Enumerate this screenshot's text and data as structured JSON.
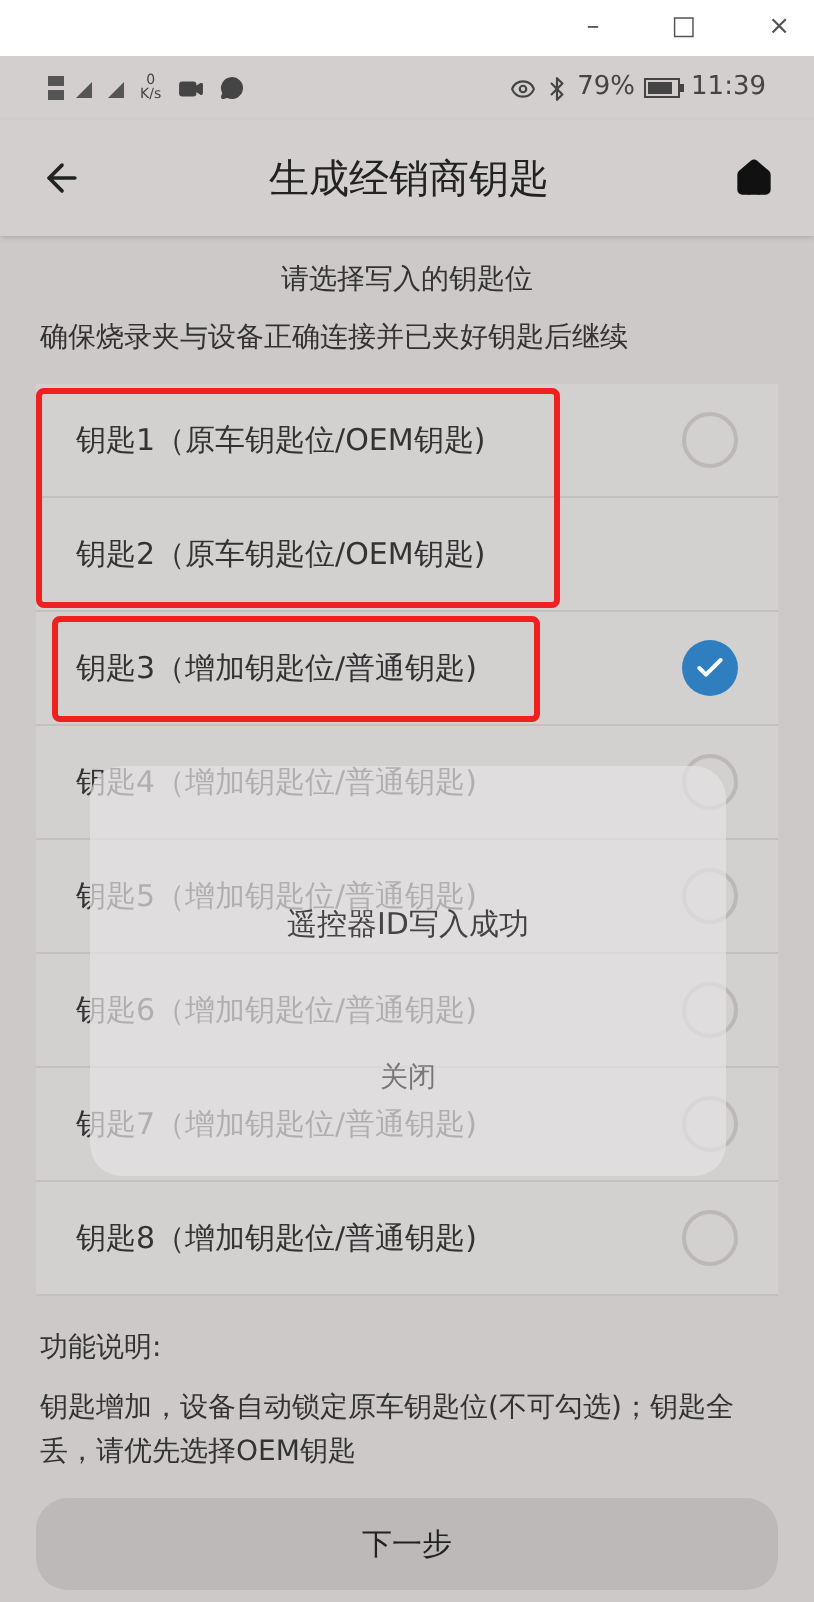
{
  "window_controls": [
    "–",
    "□",
    "×"
  ],
  "status_bar": {
    "speed": "0",
    "speed_unit": "K/s",
    "battery": "79%",
    "time": "11:39"
  },
  "header": {
    "title": "生成经销商钥匙"
  },
  "prompt": "请选择写入的钥匙位",
  "instruction": "确保烧录夹与设备正确连接并已夹好钥匙后继续",
  "keys": [
    {
      "label": "钥匙1（原车钥匙位/OEM钥匙)",
      "selected": false,
      "radio_shown": true
    },
    {
      "label": "钥匙2（原车钥匙位/OEM钥匙)",
      "selected": false,
      "radio_shown": false
    },
    {
      "label": "钥匙3（增加钥匙位/普通钥匙)",
      "selected": true,
      "radio_shown": true
    },
    {
      "label": "钥匙4（增加钥匙位/普通钥匙)",
      "selected": false,
      "radio_shown": true
    },
    {
      "label": "钥匙5（增加钥匙位/普通钥匙)",
      "selected": false,
      "radio_shown": true
    },
    {
      "label": "钥匙6（增加钥匙位/普通钥匙)",
      "selected": false,
      "radio_shown": true
    },
    {
      "label": "钥匙7（增加钥匙位/普通钥匙)",
      "selected": false,
      "radio_shown": true
    },
    {
      "label": "钥匙8（增加钥匙位/普通钥匙)",
      "selected": false,
      "radio_shown": true
    }
  ],
  "dialog": {
    "message": "遥控器ID写入成功",
    "button": "关闭"
  },
  "help": {
    "title": "功能说明:",
    "text": "钥匙增加，设备自动锁定原车钥匙位(不可勾选)；钥匙全丢，请优先选择OEM钥匙"
  },
  "next_button": "下一步"
}
